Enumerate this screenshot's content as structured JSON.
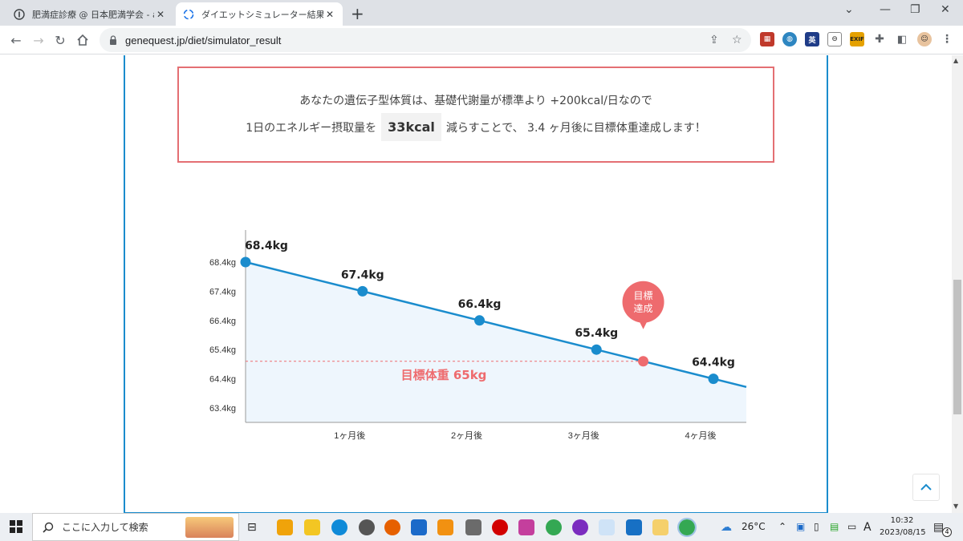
{
  "browser": {
    "tabs": [
      {
        "title": "肥満症診療 @ 日本肥満学会 - alt"
      },
      {
        "title": "ダイエットシミュレーター結果 | ダイエット"
      }
    ],
    "url": "genequest.jp/diet/simulator_result"
  },
  "result": {
    "line1": "あなたの遺伝子型体質は、基礎代謝量が標準より +200kcal/日なので",
    "line2_prefix": "1日のエネルギー摂取量を",
    "kcal": "33kcal",
    "line2_suffix": "減らすことで、 3.4 ヶ月後に目標体重達成します！"
  },
  "chart_data": {
    "type": "line",
    "x": [
      0,
      1,
      2,
      3,
      4
    ],
    "x_tick_labels": [
      "1ヶ月後",
      "2ヶ月後",
      "3ヶ月後",
      "4ヶ月後"
    ],
    "y_tick_labels": [
      "68.4kg",
      "67.4kg",
      "66.4kg",
      "65.4kg",
      "64.4kg",
      "63.4kg"
    ],
    "ylim": [
      63.4,
      68.4
    ],
    "values": [
      68.4,
      67.4,
      66.4,
      65.4,
      64.4
    ],
    "point_labels": [
      "68.4kg",
      "67.4kg",
      "66.4kg",
      "65.4kg",
      "64.4kg"
    ],
    "target": {
      "value": 65,
      "x": 3.4,
      "label": "目標体重 65kg",
      "badge_line1": "目標",
      "badge_line2": "達成"
    },
    "line_color": "#1a8ccd",
    "target_color": "#ee6b6e",
    "area_color": "#eef6fd"
  },
  "taskbar": {
    "search_placeholder": "ここに入力して検索",
    "weather": "26°C",
    "ime": "A",
    "time": "10:32",
    "date": "2023/08/15",
    "notification_count": "4"
  }
}
